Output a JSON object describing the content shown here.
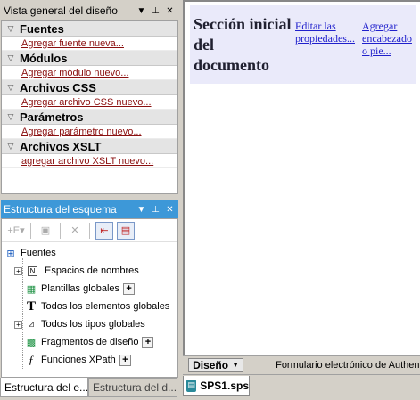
{
  "overview_panel": {
    "title": "Vista general del diseño",
    "categories": [
      {
        "name": "Fuentes",
        "link": "Agregar fuente nueva..."
      },
      {
        "name": "Módulos",
        "link": "Agregar módulo nuevo..."
      },
      {
        "name": "Archivos CSS",
        "link": "Agregar archivo CSS nuevo..."
      },
      {
        "name": "Parámetros",
        "link": "Agregar parámetro nuevo..."
      },
      {
        "name": "Archivos XSLT",
        "link": "agregar archivo XSLT nuevo..."
      }
    ]
  },
  "schema_panel": {
    "title": "Estructura del esquema",
    "tree": {
      "root": "Fuentes",
      "items": [
        {
          "label": "Espacios de nombres",
          "icon": "namespace-icon"
        },
        {
          "label": "Plantillas globales",
          "icon": "global-templates-icon"
        },
        {
          "label": "Todos los elementos globales",
          "icon": "text-t-icon"
        },
        {
          "label": "Todos los tipos globales",
          "icon": "types-icon"
        },
        {
          "label": "Fragmentos de diseño",
          "icon": "fragment-icon"
        },
        {
          "label": "Funciones XPath",
          "icon": "function-icon"
        }
      ]
    }
  },
  "left_tabs": [
    "Estructura del e...",
    "Estructura del d..."
  ],
  "design": {
    "section_title": "Sección inicial del documento",
    "link_edit": "Editar las propiedades...",
    "link_add": "Agregar encabezado o pie..."
  },
  "bottom_bar": {
    "view_button": "Diseño",
    "form_label": "Formulario electrónico de Authentic"
  },
  "file_tab": {
    "label": "SPS1.sps"
  },
  "colors": {
    "active_header": "#3d98d8",
    "link_red": "#8b1010",
    "link_blue": "#2020cc",
    "section_bg": "#eaeafa"
  }
}
